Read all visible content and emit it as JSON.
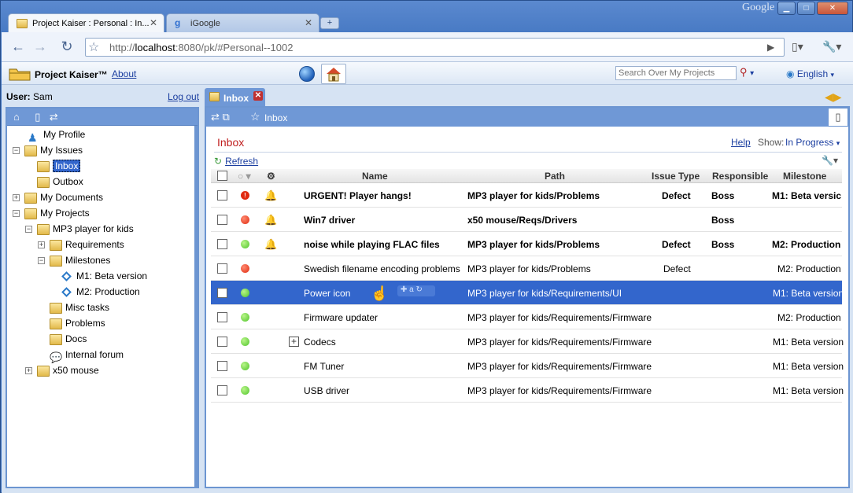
{
  "browser": {
    "tabs": [
      {
        "title": "Project Kaiser : Personal : In...",
        "active": true
      },
      {
        "title": "iGoogle",
        "active": false
      }
    ],
    "brand": "Google",
    "url_prefix": "http://",
    "url_host": "localhost",
    "url_rest": ":8080/pk/#Personal--1002"
  },
  "app": {
    "brand": "Project Kaiser™",
    "about": "About",
    "search_placeholder": "Search Over My Projects",
    "language": "English",
    "user_label": "User:",
    "user_name": "Sam",
    "logout": "Log out"
  },
  "tree": [
    {
      "label": "My Profile"
    },
    {
      "label": "My Issues"
    },
    {
      "label": "Inbox"
    },
    {
      "label": "Outbox"
    },
    {
      "label": "My Documents"
    },
    {
      "label": "My Projects"
    },
    {
      "label": "MP3 player for kids"
    },
    {
      "label": "Requirements"
    },
    {
      "label": "Milestones"
    },
    {
      "label": "M1: Beta version"
    },
    {
      "label": "M2: Production"
    },
    {
      "label": "Misc tasks"
    },
    {
      "label": "Problems"
    },
    {
      "label": "Docs"
    },
    {
      "label": "Internal forum"
    },
    {
      "label": "x50 mouse"
    }
  ],
  "main": {
    "tab": "Inbox",
    "toolbar_label": "Inbox",
    "title": "Inbox",
    "help": "Help",
    "show_label": "Show:",
    "show_value": "In Progress",
    "refresh": "Refresh",
    "columns": {
      "name": "Name",
      "path": "Path",
      "type": "Issue Type",
      "responsible": "Responsible",
      "milestone": "Milestone"
    },
    "rows": [
      {
        "name": "URGENT! Player hangs!",
        "path": "MP3 player for kids/Problems",
        "type": "Defect",
        "responsible": "Boss",
        "milestone": "M1: Beta versic"
      },
      {
        "name": "Win7 driver",
        "path": "x50 mouse/Reqs/Drivers",
        "type": "",
        "responsible": "Boss",
        "milestone": ""
      },
      {
        "name": "noise while playing FLAC files",
        "path": "MP3 player for kids/Problems",
        "type": "Defect",
        "responsible": "Boss",
        "milestone": "M2: Production"
      },
      {
        "name": "Swedish filename encoding problems",
        "path": "MP3 player for kids/Problems",
        "type": "Defect",
        "responsible": "",
        "milestone": "M2: Production"
      },
      {
        "name": "Power icon",
        "path": "MP3 player for kids/Requirements/UI",
        "type": "",
        "responsible": "",
        "milestone": "M1: Beta version"
      },
      {
        "name": "Firmware updater",
        "path": "MP3 player for kids/Requirements/Firmware",
        "type": "",
        "responsible": "",
        "milestone": "M2: Production"
      },
      {
        "name": "Codecs",
        "path": "MP3 player for kids/Requirements/Firmware",
        "type": "",
        "responsible": "",
        "milestone": "M1: Beta version"
      },
      {
        "name": "FM Tuner",
        "path": "MP3 player for kids/Requirements/Firmware",
        "type": "",
        "responsible": "",
        "milestone": "M1: Beta version"
      },
      {
        "name": "USB driver",
        "path": "MP3 player for kids/Requirements/Firmware",
        "type": "",
        "responsible": "",
        "milestone": "M1: Beta version"
      }
    ]
  },
  "colors": {
    "accent": "#3366cc",
    "panel": "#6f98d6",
    "status_red": "#e02a10",
    "status_green": "#4fc42a"
  }
}
